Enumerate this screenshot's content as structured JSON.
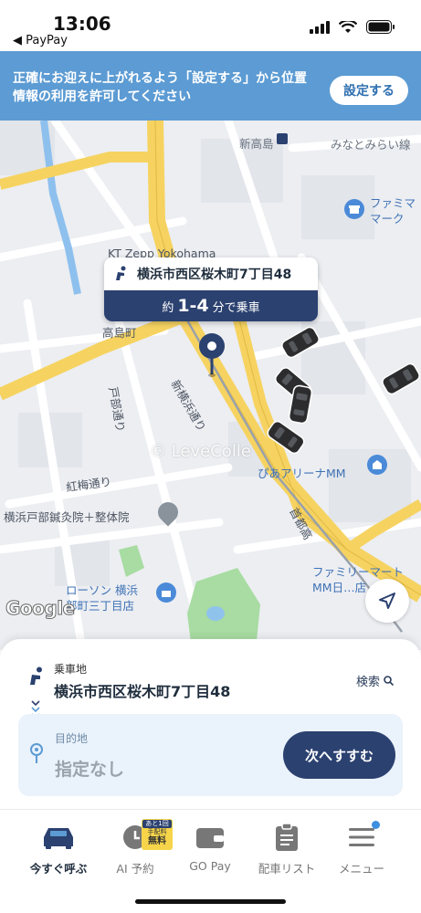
{
  "status_bar": {
    "time": "13:06",
    "back_app": "◀ PayPay"
  },
  "banner": {
    "message": "正確にお迎えに上がれるよう「設定する」から位置情報の利用を許可してください",
    "button_label": "設定する",
    "color": "#5c9bd3"
  },
  "map": {
    "labels": {
      "shintakashima": "新高島",
      "minatomirai_line": "みなとみらい線",
      "familymart_top": "ファミマ\nマーク",
      "kt_zepp": "KT Zepp Yokohama",
      "takashimacho": "高島町",
      "tobe_street": "戸部通り",
      "new_yokohama_road": "新横浜通り",
      "kobai_street": "紅梅通り",
      "pia_arena": "ぴあアリーナMM",
      "clinic": "横浜戸部鍼灸院＋整体院",
      "metro_highway": "首都高",
      "familymart_bottom": "ファミリーマート\nMM日…店",
      "lawson": "ローソン 横浜\n部町三丁目店",
      "google": "Google",
      "watermark": "© LeveColle"
    },
    "callout": {
      "address": "横浜市西区桜木町7丁目48",
      "eta_prefix": "約",
      "eta_range": "1-4",
      "eta_suffix": "分で乗車"
    },
    "icons": [
      "seat-icon",
      "pin-icon",
      "locate-arrow-icon",
      "taxi-icon"
    ]
  },
  "pickup": {
    "caption": "乗車地",
    "address": "横浜市西区桜木町7丁目48",
    "search_label": "検索"
  },
  "destination": {
    "caption": "目的地",
    "value": "指定なし",
    "next_button": "次へすすむ"
  },
  "tabs": [
    {
      "label": "今すぐ呼ぶ",
      "icon": "car-icon",
      "active": true
    },
    {
      "label": "AI 予約",
      "icon": "clock-icon",
      "active": false,
      "badge_top": "あと1回",
      "badge_mid": "手配料",
      "badge_bottom": "無料"
    },
    {
      "label": "GO Pay",
      "icon": "wallet-icon",
      "active": false
    },
    {
      "label": "配車リスト",
      "icon": "clipboard-icon",
      "active": false
    },
    {
      "label": "メニュー",
      "icon": "menu-icon",
      "active": false
    }
  ],
  "colors": {
    "navy": "#2b4170",
    "road_yellow": "#f6d361",
    "park_green": "#a8dca2"
  }
}
